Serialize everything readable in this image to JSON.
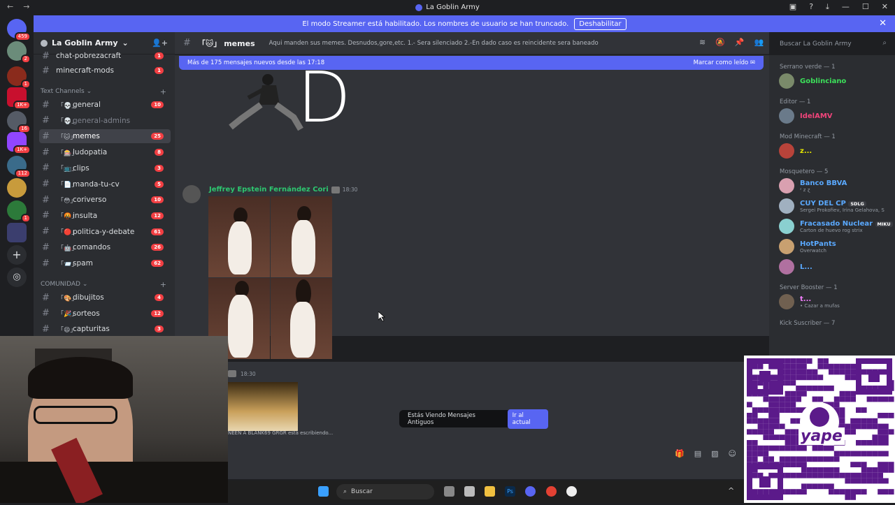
{
  "window": {
    "title": "La Goblin Army"
  },
  "notice": {
    "text": "El modo Streamer está habilitado. Los nombres de usuario se han truncado.",
    "button": "Deshabilitar"
  },
  "server": {
    "name": "La Goblin Army"
  },
  "rail": {
    "badges": [
      "459",
      "2",
      "1",
      "1K+",
      "16",
      "1K+",
      "112",
      "1"
    ]
  },
  "sidebar": {
    "top_channels": [
      {
        "name": "chat-pobrezacraft",
        "badge": "1"
      },
      {
        "name": "minecraft-mods",
        "badge": "1"
      }
    ],
    "categories": {
      "text": "Text Channels",
      "community": "COMUNIDAD"
    },
    "text_channels": [
      {
        "name": "general",
        "badge": "10",
        "emoji": "「💀」"
      },
      {
        "name": "general-admins",
        "badge": "",
        "emoji": "「💀」"
      },
      {
        "name": "memes",
        "badge": "25",
        "emoji": "「🐱」"
      },
      {
        "name": "ludopatia",
        "badge": "8",
        "emoji": "「🎰」"
      },
      {
        "name": "clips",
        "badge": "3",
        "emoji": "「📺」"
      },
      {
        "name": "manda-tu-cv",
        "badge": "5",
        "emoji": "「📄」"
      },
      {
        "name": "coriverso",
        "badge": "10",
        "emoji": "「😳」"
      },
      {
        "name": "insulta",
        "badge": "12",
        "emoji": "「🤬」"
      },
      {
        "name": "politica-y-debate",
        "badge": "61",
        "emoji": "「🔴」"
      },
      {
        "name": "comandos",
        "badge": "26",
        "emoji": "「🤖」"
      },
      {
        "name": "spam",
        "badge": "62",
        "emoji": "「📨」"
      }
    ],
    "community_channels": [
      {
        "name": "dibujitos",
        "badge": "4",
        "emoji": "「🎨」"
      },
      {
        "name": "sorteos",
        "badge": "12",
        "emoji": "「🎉」"
      },
      {
        "name": "capturitas",
        "badge": "3",
        "emoji": "「😄」"
      }
    ]
  },
  "chat": {
    "channel": "memes",
    "channel_emoji": "「🐱」",
    "topic": "Aqui manden sus memes. Desnudos,gore,etc. 1.- Sera silenciado 2.-En dado caso es reincidente sera baneado",
    "search_placeholder": "Buscar La Goblin Army",
    "new_messages": "Más de 175 mensajes nuevos desde las 17:18",
    "mark_read": "Marcar como leído",
    "big_letter": "D",
    "message": {
      "author": "Jeffrey Epstein Fernández Cori",
      "time": "18:30"
    },
    "message2_time": "18:30",
    "jump_text": "Estás Viendo Mensajes Antiguos",
    "jump_button": "Ir al actual",
    "typing": "NEEN A BLANK69 GRGR está escribiendo..."
  },
  "members": {
    "groups": [
      {
        "label": "Serrano verde — 1",
        "members": [
          {
            "name": "Goblinciano",
            "status": "",
            "color": "#3ce05a"
          }
        ]
      },
      {
        "label": "Editor — 1",
        "members": [
          {
            "name": "IdelAMV",
            "status": "",
            "color": "#f0447a"
          }
        ]
      },
      {
        "label": "Mod Minecraft — 1",
        "members": [
          {
            "name": "z...",
            "status": "",
            "color": "#e6e600"
          }
        ]
      },
      {
        "label": "Mosquetero — 5",
        "members": [
          {
            "name": "Banco BBVA",
            "status": "ᶻ z ɀ",
            "color": "#5aa9ff"
          },
          {
            "name": "CUY DEL CP",
            "status": "Sergei Prokofiev, Irina Gelahova, S",
            "color": "#5aa9ff",
            "tag": "SDLG"
          },
          {
            "name": "Fracasado Nuclear",
            "status": "Carton de huevo rog strix",
            "color": "#5aa9ff",
            "tag": "MIKU"
          },
          {
            "name": "HotPants",
            "status": "Overwatch",
            "color": "#5aa9ff"
          },
          {
            "name": "L...",
            "status": "",
            "color": "#5aa9ff"
          }
        ]
      },
      {
        "label": "Server Booster — 1",
        "members": [
          {
            "name": "t...",
            "status": "• Cazar a mufas",
            "color": "#f47fff"
          }
        ]
      },
      {
        "label": "Kick Suscriber — 7",
        "members": []
      }
    ]
  },
  "qr": {
    "label": "yape"
  },
  "taskbar": {
    "search": "Buscar"
  },
  "colors": {
    "accent": "#5865f2",
    "badge": "#f23f43",
    "bg_main": "#313338",
    "bg_side": "#2b2d31"
  }
}
